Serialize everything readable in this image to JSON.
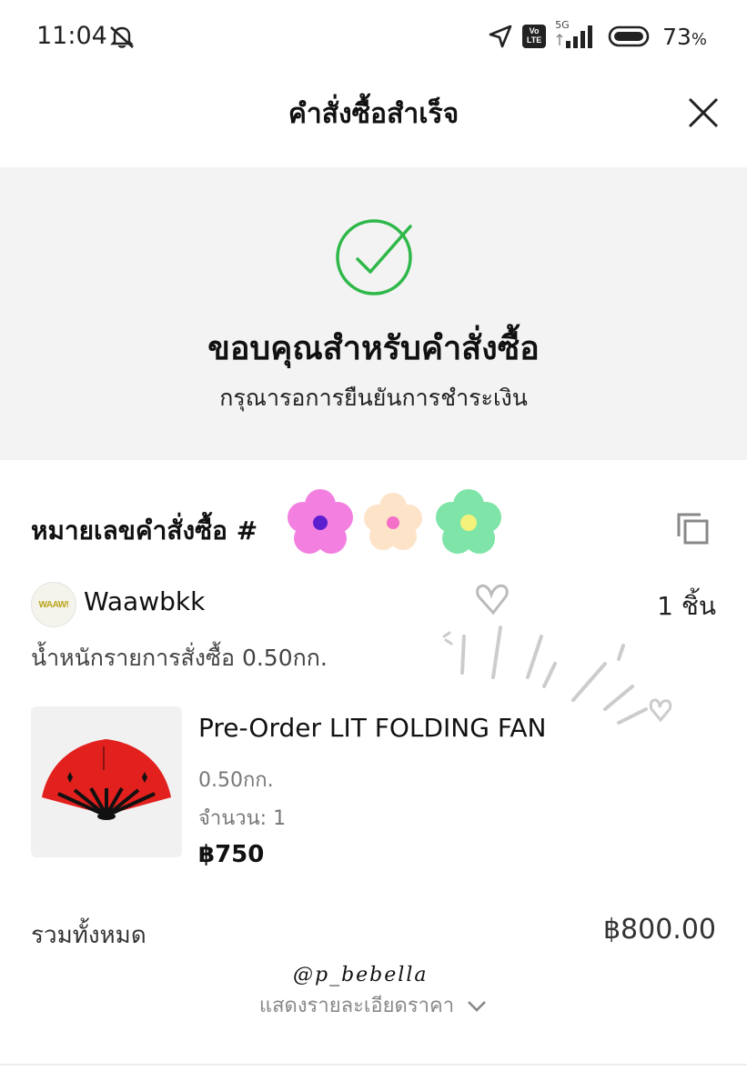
{
  "status_bar": {
    "time": "11:04",
    "network": "5G",
    "volte": "Vo LTE",
    "battery_percent": "73",
    "percent_sign": "%"
  },
  "header": {
    "title": "คำสั่งซื้อสำเร็จ"
  },
  "success": {
    "heading": "ขอบคุณสำหรับคำสั่งซื้อ",
    "subtext": "กรุณารอการยืนยันการชำระเงิน",
    "accent_color": "#2fb84a"
  },
  "order": {
    "number_label": "หมายเลขคำสั่งซื้อ #",
    "shop_logo_text": "WAAW!",
    "shop_name": "Waawbkk",
    "piece_count": "1 ชิ้น",
    "weight_line": "น้ำหนักรายการสั่งซื้อ 0.50กก.",
    "item": {
      "name": "Pre-Order LIT FOLDING FAN",
      "weight": "0.50กก.",
      "quantity": "จำนวน: 1",
      "price": "฿750"
    },
    "total_label": "รวมทั้งหมด",
    "total_value": "฿800.00",
    "details_link": "แสดงรายละเอียดราคา"
  },
  "watermark": "@p_bebella",
  "icons": {
    "mute": "bell-mute-icon",
    "location": "location-arrow-icon",
    "signal": "signal-icon",
    "battery": "battery-icon",
    "close": "close-icon",
    "check": "check-circle-icon",
    "copy": "copy-icon",
    "chevron": "chevron-down-icon"
  }
}
